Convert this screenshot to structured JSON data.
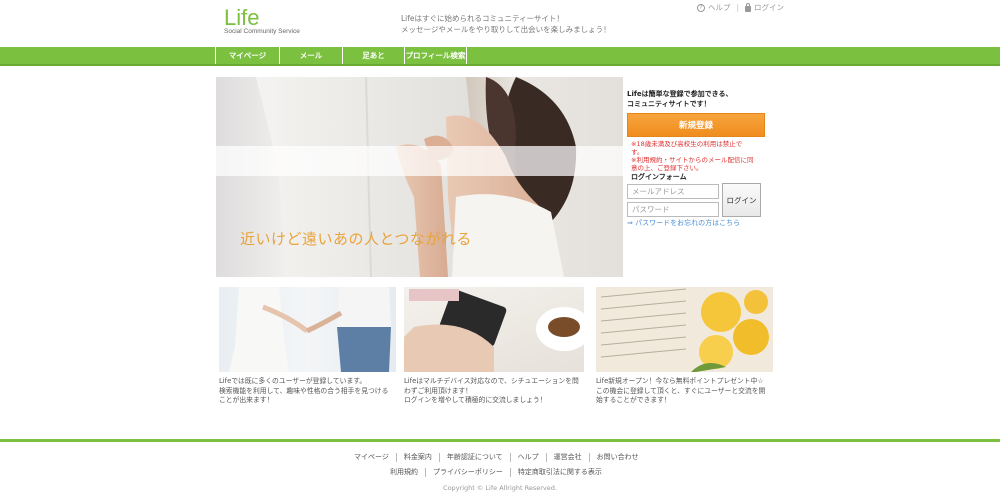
{
  "header": {
    "logo": "Life",
    "logo_sub": "Social Community Service",
    "tagline_1": "Lifeはすぐに始められるコミュニティーサイト！",
    "tagline_2": "メッセージやメールをやり取りして出会いを楽しみましょう！",
    "help_label": "ヘルプ",
    "login_label": "ログイン"
  },
  "nav": {
    "items": [
      "マイページ",
      "メール",
      "足あと",
      "プロフィール検索"
    ]
  },
  "hero": {
    "caption": "近いけど遠いあの人とつながれる"
  },
  "side": {
    "intro_1": "Lifeは簡単な登録で参加できる、",
    "intro_2": "コミュニティサイトです！",
    "register_label": "新規登録",
    "note_1": "※18歳未満及び高校生の利用は禁止で",
    "note_2": "す。",
    "note_3": "※利用規約・サイトからのメール配信に同",
    "note_4": "意の上、ご登録下さい。",
    "form_title": "ログインフォーム",
    "email_placeholder": "メールアドレス",
    "password_placeholder": "パスワード",
    "login_button": "ログイン",
    "forgot_link": "⇒ パスワードをお忘れの方はこちら"
  },
  "features": [
    {
      "line_1": "Lifeでは既に多くのユーザーが登録しています。",
      "line_2": "検索機能を利用して、趣味や性格の合う相手を見つける",
      "line_3": "ことが出来ます！"
    },
    {
      "line_1": "Lifeはマルチデバイス対応なので、シチュエーションを問",
      "line_2": "わずご利用頂けます！",
      "line_3": "ログインを増やして積極的に交流しましょう！"
    },
    {
      "line_1": "Life新規オープン！今なら無料ポイントプレゼント中☆",
      "line_2": "この機会に登録して頂くと、すぐにユーザーと交流を開",
      "line_3": "始することができます！"
    }
  ],
  "footer": {
    "row1": [
      "マイページ",
      "料金案内",
      "年齢認証について",
      "ヘルプ",
      "運営会社",
      "お問い合わせ"
    ],
    "row2": [
      "利用規約",
      "プライバシーポリシー",
      "特定商取引法に関する表示"
    ],
    "copyright": "Copyright © Life Allright Reserved."
  },
  "colors": {
    "brand_green": "#7cc040",
    "register_orange": "#f29a2e",
    "caption_orange": "#e8a33b",
    "note_red": "#e03030",
    "link_blue": "#4a8ed8"
  }
}
